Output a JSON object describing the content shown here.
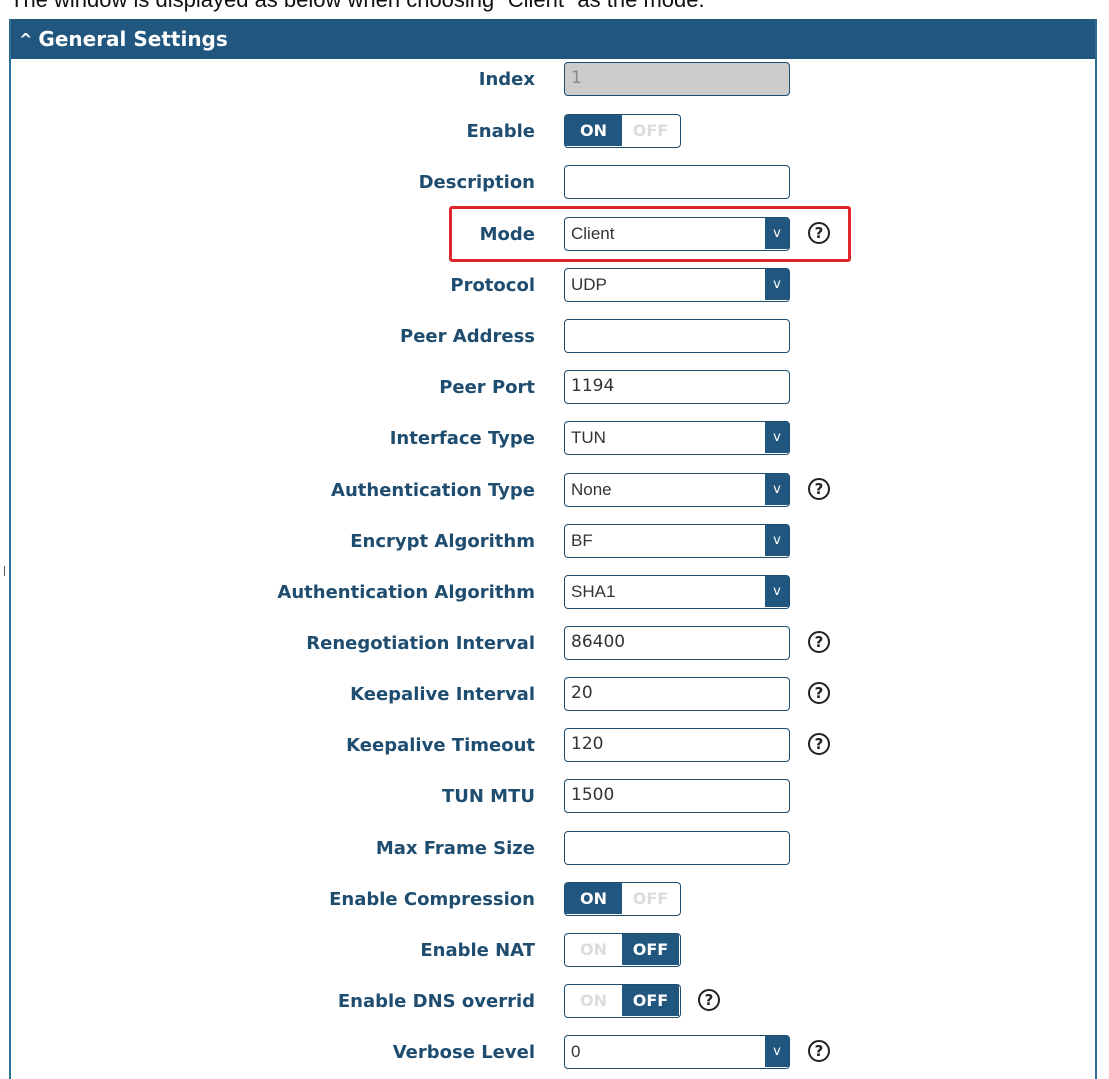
{
  "intro_text": "The window is displayed as below when choosing “Client” as the mode.",
  "panel": {
    "caret_icon": "chevron-up-icon",
    "title": "General Settings"
  },
  "fields": {
    "index": {
      "label": "Index",
      "value": "1"
    },
    "enable": {
      "label": "Enable",
      "on": "ON",
      "off": "OFF",
      "state": "on"
    },
    "description": {
      "label": "Description",
      "value": ""
    },
    "mode": {
      "label": "Mode",
      "value": "Client"
    },
    "protocol": {
      "label": "Protocol",
      "value": "UDP"
    },
    "peer_address": {
      "label": "Peer Address",
      "value": ""
    },
    "peer_port": {
      "label": "Peer Port",
      "value": "1194"
    },
    "interface_type": {
      "label": "Interface Type",
      "value": "TUN"
    },
    "authentication_type": {
      "label": "Authentication Type",
      "value": "None"
    },
    "encrypt_algorithm": {
      "label": "Encrypt Algorithm",
      "value": "BF"
    },
    "authentication_algorithm": {
      "label": "Authentication Algorithm",
      "value": "SHA1"
    },
    "renegotiation_interval": {
      "label": "Renegotiation Interval",
      "value": "86400"
    },
    "keepalive_interval": {
      "label": "Keepalive Interval",
      "value": "20"
    },
    "keepalive_timeout": {
      "label": "Keepalive Timeout",
      "value": "120"
    },
    "tun_mtu": {
      "label": "TUN MTU",
      "value": "1500"
    },
    "max_frame_size": {
      "label": "Max Frame Size",
      "value": ""
    },
    "enable_compression": {
      "label": "Enable Compression",
      "on": "ON",
      "off": "OFF",
      "state": "on"
    },
    "enable_nat": {
      "label": "Enable NAT",
      "on": "ON",
      "off": "OFF",
      "state": "off"
    },
    "enable_dns_override": {
      "label": "Enable DNS overrid",
      "on": "ON",
      "off": "OFF",
      "state": "off"
    },
    "verbose_level": {
      "label": "Verbose Level",
      "value": "0"
    }
  },
  "select_arrow": "v",
  "help_glyph": "?",
  "colors": {
    "header_bg": "#21577f",
    "label": "#1f4d70",
    "highlight": "#e0262b",
    "toggle_active": "#21577f"
  }
}
